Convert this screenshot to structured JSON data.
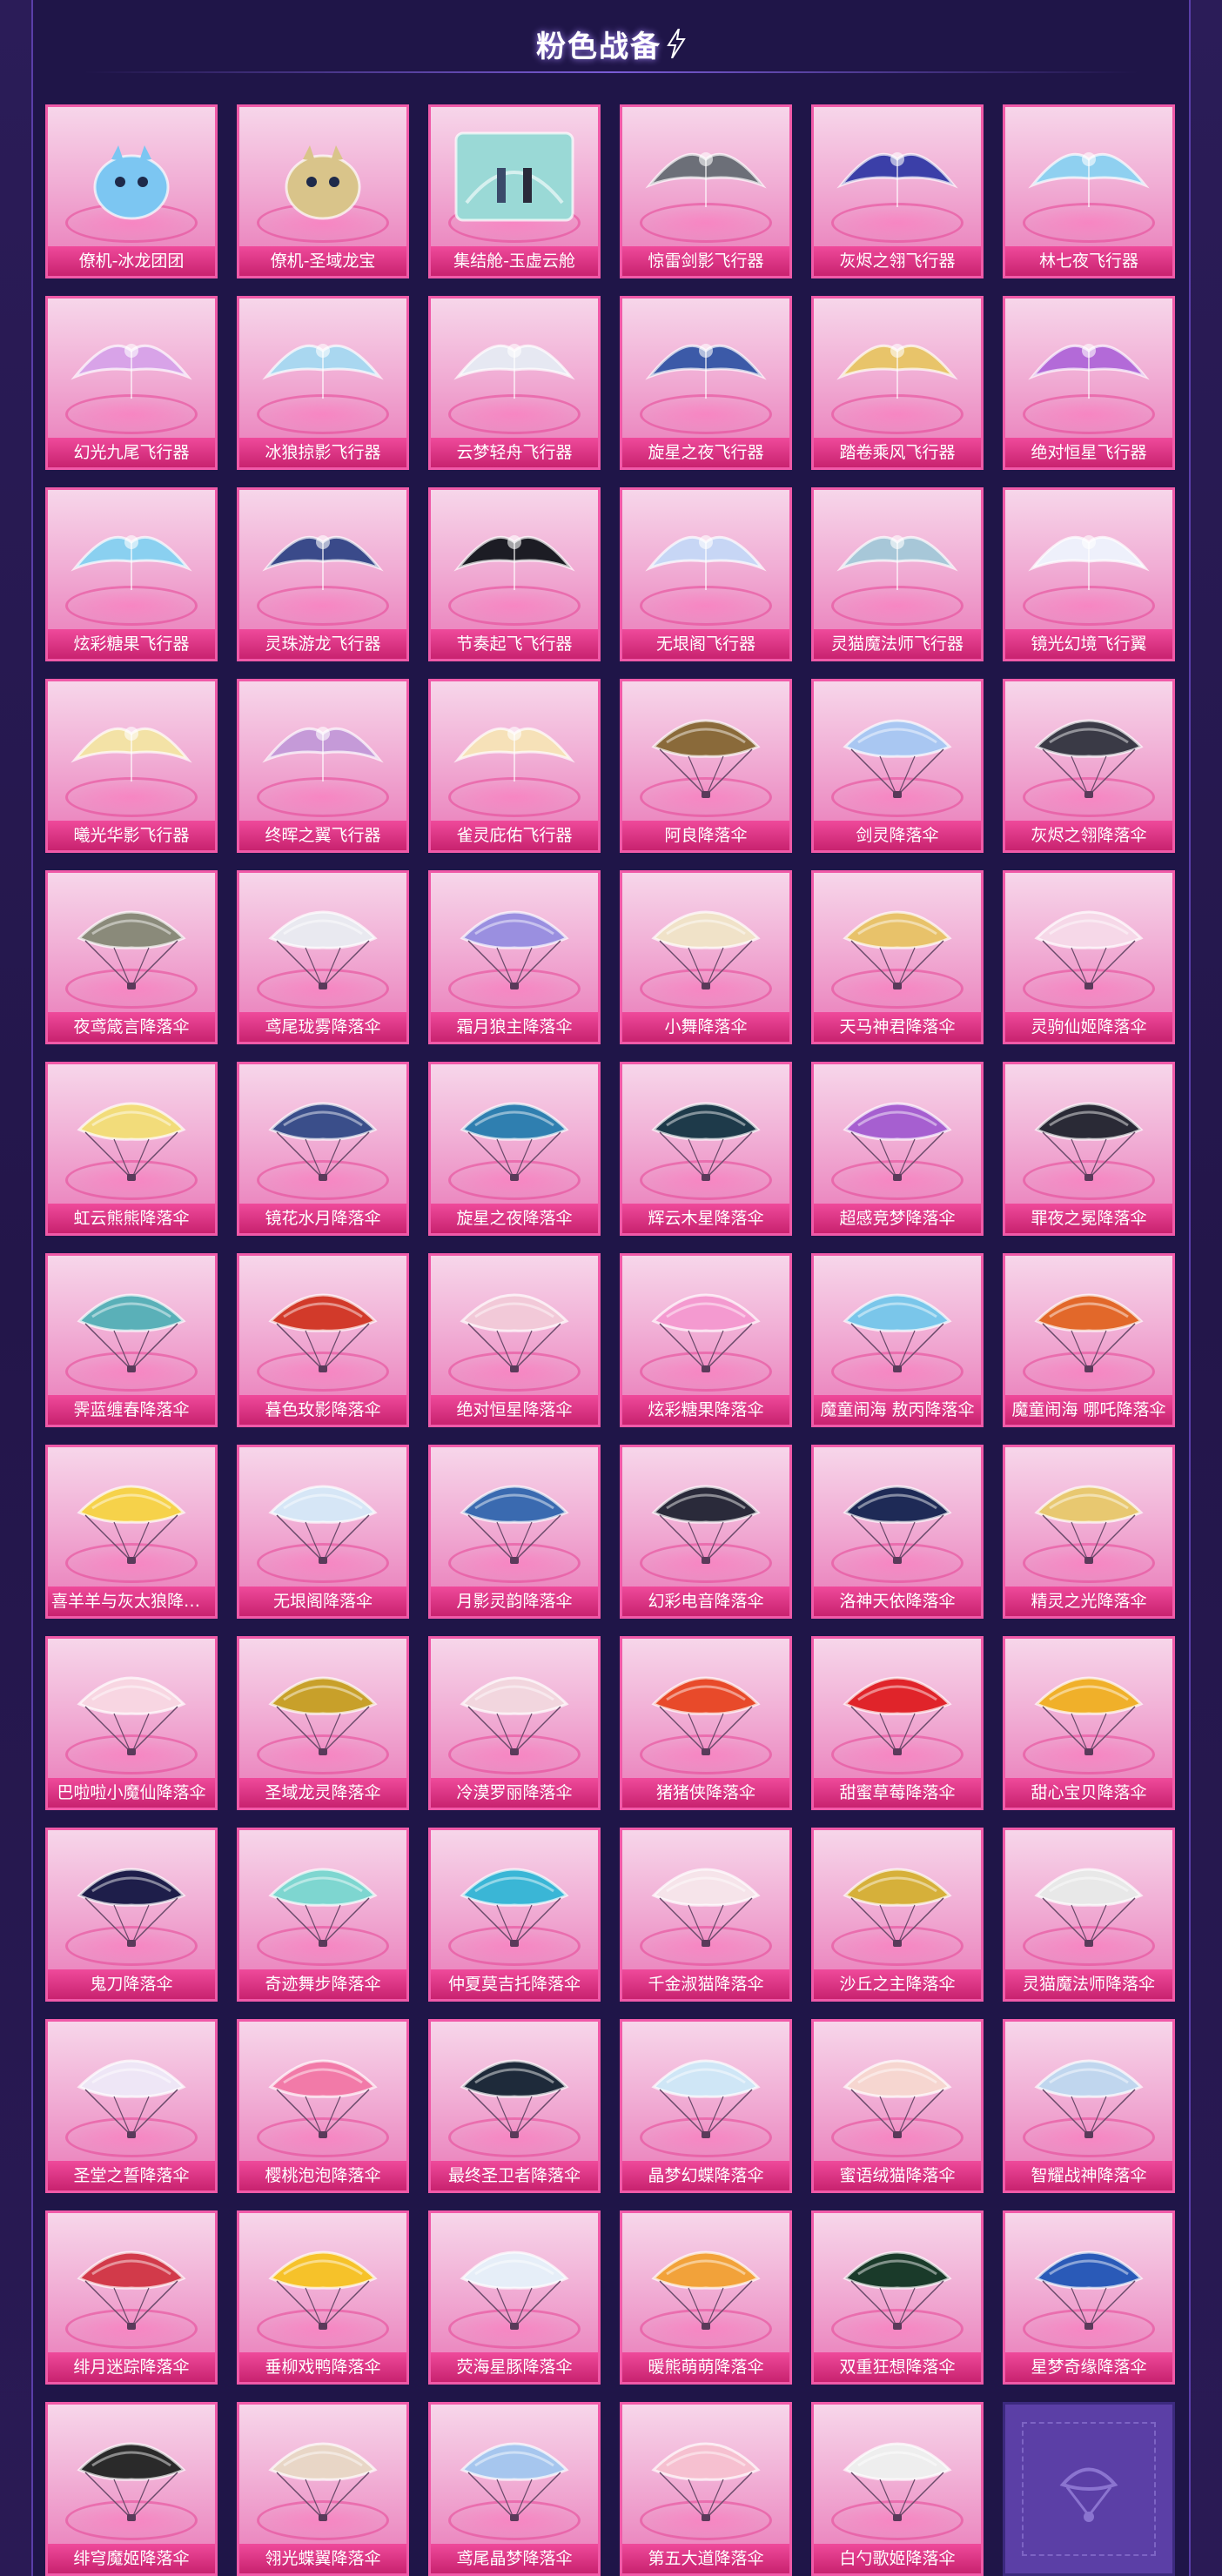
{
  "header": {
    "title": "粉色战备"
  },
  "items": [
    {
      "label": "僚机-冰龙团团",
      "icon": "ice-dragon-pet-icon",
      "kind": "pet",
      "color": "#7cc6f2"
    },
    {
      "label": "僚机-圣域龙宝",
      "icon": "sanctum-dragon-pet-icon",
      "kind": "pet",
      "color": "#d9c48a"
    },
    {
      "label": "集结舱-玉虚云舱",
      "icon": "cloud-pod-icon",
      "kind": "pod",
      "color": "#9ad9d6"
    },
    {
      "label": "惊雷剑影飞行器",
      "icon": "sword-glider-icon",
      "kind": "glider",
      "color": "#6c6f78"
    },
    {
      "label": "灰烬之翎飞行器",
      "icon": "ash-feather-glider-icon",
      "kind": "glider",
      "color": "#3b3fa8"
    },
    {
      "label": "林七夜飞行器",
      "icon": "moon-glider-icon",
      "kind": "glider",
      "color": "#8fd0f0"
    },
    {
      "label": "幻光九尾飞行器",
      "icon": "ninetail-glider-icon",
      "kind": "glider",
      "color": "#d8a3e8"
    },
    {
      "label": "冰狼掠影飞行器",
      "icon": "ice-wolf-glider-icon",
      "kind": "glider",
      "color": "#a9d7f0"
    },
    {
      "label": "云梦轻舟飞行器",
      "icon": "cloud-boat-glider-icon",
      "kind": "glider",
      "color": "#e6e8f2"
    },
    {
      "label": "旋星之夜飞行器",
      "icon": "starry-night-glider-icon",
      "kind": "glider",
      "color": "#3c5aa8"
    },
    {
      "label": "踏卷乘风飞行器",
      "icon": "scroll-glider-icon",
      "kind": "glider",
      "color": "#e8c46a"
    },
    {
      "label": "绝对恒星飞行器",
      "icon": "star-orb-glider-icon",
      "kind": "glider",
      "color": "#b36ad8"
    },
    {
      "label": "炫彩糖果飞行器",
      "icon": "candy-glider-icon",
      "kind": "glider",
      "color": "#8ad0f0"
    },
    {
      "label": "灵珠游龙飞行器",
      "icon": "pearl-dragon-glider-icon",
      "kind": "glider",
      "color": "#3a4a8a"
    },
    {
      "label": "节奏起飞飞行器",
      "icon": "cat-helmet-glider-icon",
      "kind": "glider",
      "color": "#1c1c24"
    },
    {
      "label": "无垠阁飞行器",
      "icon": "crystal-glider-icon",
      "kind": "glider",
      "color": "#c7d6f5"
    },
    {
      "label": "灵猫魔法师飞行器",
      "icon": "magic-cat-glider-icon",
      "kind": "glider",
      "color": "#a7c7d8"
    },
    {
      "label": "镜光幻境飞行翼",
      "icon": "mirror-wing-glider-icon",
      "kind": "glider",
      "color": "#eef0fb"
    },
    {
      "label": "曦光华影飞行器",
      "icon": "flower-glider-icon",
      "kind": "glider",
      "color": "#f3e2a6"
    },
    {
      "label": "终晖之翼飞行器",
      "icon": "wings-glider-icon",
      "kind": "glider",
      "color": "#c59ad8"
    },
    {
      "label": "雀灵庇佑飞行器",
      "icon": "fairy-glider-icon",
      "kind": "glider",
      "color": "#f6e1b8"
    },
    {
      "label": "阿良降落伞",
      "icon": "feather-parachute-icon",
      "kind": "chute",
      "color": "#8a6a3a"
    },
    {
      "label": "剑灵降落伞",
      "icon": "blossom-parachute-icon",
      "kind": "chute",
      "color": "#a9c7f2"
    },
    {
      "label": "灰烬之翎降落伞",
      "icon": "ash-parachute-icon",
      "kind": "chute",
      "color": "#3a3a46"
    },
    {
      "label": "夜鸢箴言降落伞",
      "icon": "kite-parachute-icon",
      "kind": "chute",
      "color": "#8a8a7a"
    },
    {
      "label": "鸢尾珑雾降落伞",
      "icon": "iris-parachute-icon",
      "kind": "chute",
      "color": "#e9e9f0"
    },
    {
      "label": "霜月狼主降落伞",
      "icon": "wolf-parachute-icon",
      "kind": "chute",
      "color": "#9a8fe0"
    },
    {
      "label": "小舞降落伞",
      "icon": "dance-parachute-icon",
      "kind": "chute",
      "color": "#f0e2c8"
    },
    {
      "label": "天马神君降落伞",
      "icon": "pegasus-parachute-icon",
      "kind": "chute",
      "color": "#e8c26a"
    },
    {
      "label": "灵驹仙姬降落伞",
      "icon": "pony-parachute-icon",
      "kind": "chute",
      "color": "#f6d8e8"
    },
    {
      "label": "虹云熊熊降落伞",
      "icon": "rainbow-bear-parachute-icon",
      "kind": "chute",
      "color": "#f2dc7a"
    },
    {
      "label": "镜花水月降落伞",
      "icon": "moon-water-parachute-icon",
      "kind": "chute",
      "color": "#3a4e8a"
    },
    {
      "label": "旋星之夜降落伞",
      "icon": "starry-parachute-icon",
      "kind": "chute",
      "color": "#2f7fb0"
    },
    {
      "label": "辉云木星降落伞",
      "icon": "jupiter-parachute-icon",
      "kind": "chute",
      "color": "#1e3a4a"
    },
    {
      "label": "超感竞梦降落伞",
      "icon": "dream-parachute-icon",
      "kind": "chute",
      "color": "#a65fd0"
    },
    {
      "label": "罪夜之冕降落伞",
      "icon": "crown-parachute-icon",
      "kind": "chute",
      "color": "#2a2a36"
    },
    {
      "label": "霁蓝缠春降落伞",
      "icon": "spring-parachute-icon",
      "kind": "chute",
      "color": "#5ab0b8"
    },
    {
      "label": "暮色玫影降落伞",
      "icon": "rose-parachute-icon",
      "kind": "chute",
      "color": "#d23a2a"
    },
    {
      "label": "绝对恒星降落伞",
      "icon": "star-orb-parachute-icon",
      "kind": "chute",
      "color": "#f2c9d8"
    },
    {
      "label": "炫彩糖果降落伞",
      "icon": "candy-parachute-icon",
      "kind": "chute",
      "color": "#f49ad0"
    },
    {
      "label": "魔童闹海 敖丙降落伞",
      "icon": "aobing-parachute-icon",
      "kind": "chute",
      "color": "#7ac6ea"
    },
    {
      "label": "魔童闹海 哪吒降落伞",
      "icon": "nezha-parachute-icon",
      "kind": "chute",
      "color": "#e2682a"
    },
    {
      "label": "喜羊羊与灰太狼降落伞",
      "icon": "sheep-parachute-icon",
      "kind": "chute",
      "color": "#f6d24a"
    },
    {
      "label": "无垠阁降落伞",
      "icon": "crystal-parachute-icon",
      "kind": "chute",
      "color": "#d6e6f6"
    },
    {
      "label": "月影灵韵降落伞",
      "icon": "moonshadow-parachute-icon",
      "kind": "chute",
      "color": "#3a6ab0"
    },
    {
      "label": "幻彩电音降落伞",
      "icon": "dj-parachute-icon",
      "kind": "chute",
      "color": "#2a2a3a"
    },
    {
      "label": "洛神天依降落伞",
      "icon": "luoshen-parachute-icon",
      "kind": "chute",
      "color": "#1e2a56"
    },
    {
      "label": "精灵之光降落伞",
      "icon": "elf-light-parachute-icon",
      "kind": "chute",
      "color": "#e8c870"
    },
    {
      "label": "巴啦啦小魔仙降落伞",
      "icon": "balala-parachute-icon",
      "kind": "chute",
      "color": "#f8d6e2"
    },
    {
      "label": "圣域龙灵降落伞",
      "icon": "sanctum-parachute-icon",
      "kind": "chute",
      "color": "#c8a02a"
    },
    {
      "label": "冷漠罗丽降落伞",
      "icon": "lolly-parachute-icon",
      "kind": "chute",
      "color": "#f2d6de"
    },
    {
      "label": "猪猪侠降落伞",
      "icon": "gg-bond-parachute-icon",
      "kind": "chute",
      "color": "#e84a2a"
    },
    {
      "label": "甜蜜草莓降落伞",
      "icon": "strawberry-parachute-icon",
      "kind": "chute",
      "color": "#e0242a"
    },
    {
      "label": "甜心宝贝降落伞",
      "icon": "sweetheart-parachute-icon",
      "kind": "chute",
      "color": "#f0b02a"
    },
    {
      "label": "鬼刀降落伞",
      "icon": "ghostblade-parachute-icon",
      "kind": "chute",
      "color": "#1e1e4a"
    },
    {
      "label": "奇迹舞步降落伞",
      "icon": "dance-step-parachute-icon",
      "kind": "chute",
      "color": "#7ed6d0"
    },
    {
      "label": "仲夏莫吉托降落伞",
      "icon": "mojito-parachute-icon",
      "kind": "chute",
      "color": "#3ab6d6"
    },
    {
      "label": "千金淑猫降落伞",
      "icon": "lady-cat-parachute-icon",
      "kind": "chute",
      "color": "#f6e4ea"
    },
    {
      "label": "沙丘之主降落伞",
      "icon": "dune-parachute-icon",
      "kind": "chute",
      "color": "#d6b03a"
    },
    {
      "label": "灵猫魔法师降落伞",
      "icon": "magic-cat-parachute-icon",
      "kind": "chute",
      "color": "#e8e8e8"
    },
    {
      "label": "圣堂之誓降落伞",
      "icon": "temple-parachute-icon",
      "kind": "chute",
      "color": "#eee6f6"
    },
    {
      "label": "樱桃泡泡降落伞",
      "icon": "cherry-parachute-icon",
      "kind": "chute",
      "color": "#f27aa8"
    },
    {
      "label": "最终圣卫者降落伞",
      "icon": "guardian-parachute-icon",
      "kind": "chute",
      "color": "#1e2a3a"
    },
    {
      "label": "晶梦幻蝶降落伞",
      "icon": "butterfly-parachute-icon",
      "kind": "chute",
      "color": "#cfe6f6"
    },
    {
      "label": "蜜语绒猫降落伞",
      "icon": "plush-cat-parachute-icon",
      "kind": "chute",
      "color": "#f6d6d0"
    },
    {
      "label": "智耀战神降落伞",
      "icon": "war-god-parachute-icon",
      "kind": "chute",
      "color": "#c0d6ee"
    },
    {
      "label": "绯月迷踪降落伞",
      "icon": "crimson-moon-parachute-icon",
      "kind": "chute",
      "color": "#d23a4a"
    },
    {
      "label": "垂柳戏鸭降落伞",
      "icon": "duck-parachute-icon",
      "kind": "chute",
      "color": "#f6c22a"
    },
    {
      "label": "荧海星豚降落伞",
      "icon": "dolphin-parachute-icon",
      "kind": "chute",
      "color": "#e6eef8"
    },
    {
      "label": "暖熊萌萌降落伞",
      "icon": "red-panda-parachute-icon",
      "kind": "chute",
      "color": "#f2a23a"
    },
    {
      "label": "双重狂想降落伞",
      "icon": "rhapsody-parachute-icon",
      "kind": "chute",
      "color": "#1a3a2a"
    },
    {
      "label": "星梦奇缘降落伞",
      "icon": "star-dream-parachute-icon",
      "kind": "chute",
      "color": "#2a5ab8"
    },
    {
      "label": "绯穹魔姬降落伞",
      "icon": "sorceress-parachute-icon",
      "kind": "chute",
      "color": "#2a2a2a"
    },
    {
      "label": "翎光蝶翼降落伞",
      "icon": "feather-wing-parachute-icon",
      "kind": "chute",
      "color": "#e8d6c6"
    },
    {
      "label": "鸢尾晶梦降落伞",
      "icon": "iris-dream-parachute-icon",
      "kind": "chute",
      "color": "#a6c6ee"
    },
    {
      "label": "第五大道降落伞",
      "icon": "fifth-avenue-parachute-icon",
      "kind": "chute",
      "color": "#f6c0d0"
    },
    {
      "label": "白勺歌姬降落伞",
      "icon": "diva-parachute-icon",
      "kind": "chute",
      "color": "#eeeeee"
    }
  ],
  "placeholder": {
    "icon": "locked-parachute-placeholder-icon"
  },
  "colors": {
    "page_bg": "#2a1a52",
    "card_border": "#f05aa8",
    "label_bg": "#c8226f",
    "placeholder_bg": "#5b3fa6"
  }
}
